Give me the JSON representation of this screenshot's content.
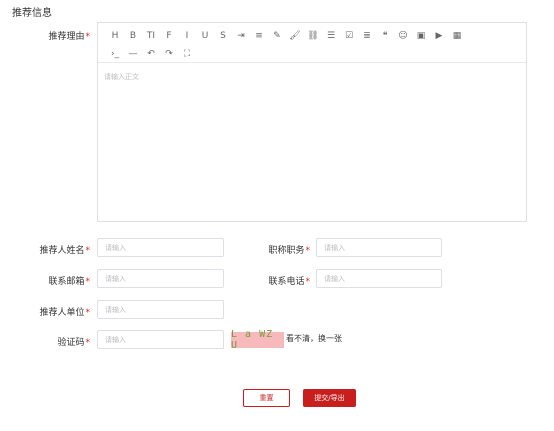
{
  "section_title": "推荐信息",
  "reason": {
    "label": "推荐理由",
    "required_mark": "*",
    "editor_placeholder": "请输入正文",
    "toolbar_row1": [
      {
        "name": "heading",
        "glyph": "H"
      },
      {
        "name": "bold",
        "glyph": "B"
      },
      {
        "name": "font-size",
        "glyph": "TI"
      },
      {
        "name": "font-family",
        "glyph": "F"
      },
      {
        "name": "italic",
        "glyph": "I"
      },
      {
        "name": "underline",
        "glyph": "U"
      },
      {
        "name": "strikethrough",
        "glyph": "S"
      },
      {
        "name": "indent",
        "glyph": "⇥"
      },
      {
        "name": "align",
        "glyph": "≡"
      },
      {
        "name": "text-color",
        "glyph": "✎"
      },
      {
        "name": "background-color",
        "glyph": "🖌"
      },
      {
        "name": "link",
        "glyph": "⛓"
      },
      {
        "name": "list",
        "glyph": "☰"
      },
      {
        "name": "todo",
        "glyph": "☑"
      },
      {
        "name": "justify",
        "glyph": "≣"
      },
      {
        "name": "quote",
        "glyph": "❝"
      },
      {
        "name": "emoticon",
        "glyph": "☺"
      },
      {
        "name": "image",
        "glyph": "▣"
      },
      {
        "name": "video",
        "glyph": "▶"
      },
      {
        "name": "table",
        "glyph": "▦"
      }
    ],
    "toolbar_row2": [
      {
        "name": "code",
        "glyph": "›_"
      },
      {
        "name": "divider",
        "glyph": "—"
      },
      {
        "name": "undo",
        "glyph": "↶"
      },
      {
        "name": "redo",
        "glyph": "↷"
      },
      {
        "name": "fullscreen",
        "glyph": "⛶"
      }
    ]
  },
  "fields": {
    "recommender_name": {
      "label": "推荐人姓名",
      "placeholder": "请输入"
    },
    "job_title": {
      "label": "职称职务",
      "placeholder": "请输入"
    },
    "email": {
      "label": "联系邮箱",
      "placeholder": "请输入"
    },
    "phone": {
      "label": "联系电话",
      "placeholder": "请输入"
    },
    "organization": {
      "label": "推荐人单位",
      "placeholder": "请输入"
    },
    "captcha": {
      "label": "验证码",
      "placeholder": "请输入"
    }
  },
  "captcha_text": "L a WZ U",
  "captcha_refresh": "看不清，换一张",
  "buttons": {
    "reset": "重置",
    "submit": "提交/导出"
  },
  "colors": {
    "accent": "#c81e1e",
    "required": "#e02020",
    "captcha_bg": "#f7b9bb"
  }
}
